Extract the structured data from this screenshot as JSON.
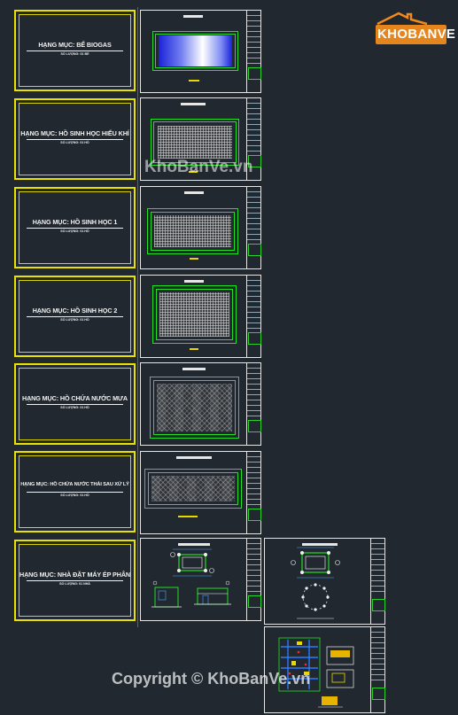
{
  "covers": [
    {
      "title": "HẠNG MỤC: BỂ BIOGAS",
      "sub": "SỐ LƯỢNG: 01 BỂ"
    },
    {
      "title": "HẠNG MỤC: HỒ SINH HỌC HIẾU KHÍ",
      "sub": "SỐ LƯỢNG: 01 HỒ"
    },
    {
      "title": "HẠNG MỤC: HỒ SINH HỌC 1",
      "sub": "SỐ LƯỢNG: 01 HỒ"
    },
    {
      "title": "HẠNG MỤC: HỒ SINH HỌC 2",
      "sub": "SỐ LƯỢNG: 01 HỒ"
    },
    {
      "title": "HẠNG MỤC: HỒ CHỨA NƯỚC MƯA",
      "sub": "SỐ LƯỢNG: 01 HỒ"
    },
    {
      "title": "HẠNG MỤC: HỒ CHỨA NƯỚC THẢI SAU XỬ LÝ",
      "sub": "SỐ LƯỢNG: 01 HỒ"
    },
    {
      "title": "HẠNG MỤC: NHÀ ĐẶT MÁY ÉP PHÂN",
      "sub": "SỐ LƯỢNG: 01 NHÀ"
    }
  ],
  "logo": {
    "brand": "KHOBANVE"
  },
  "watermarks": {
    "center": "KhoBanVe.vn",
    "footer": "Copyright © KhoBanVe.vn"
  },
  "colors": {
    "background": "#212830",
    "cover_border": "#e9e100",
    "pond_outline": "#22e022",
    "logo_orange": "#f08a1c"
  }
}
